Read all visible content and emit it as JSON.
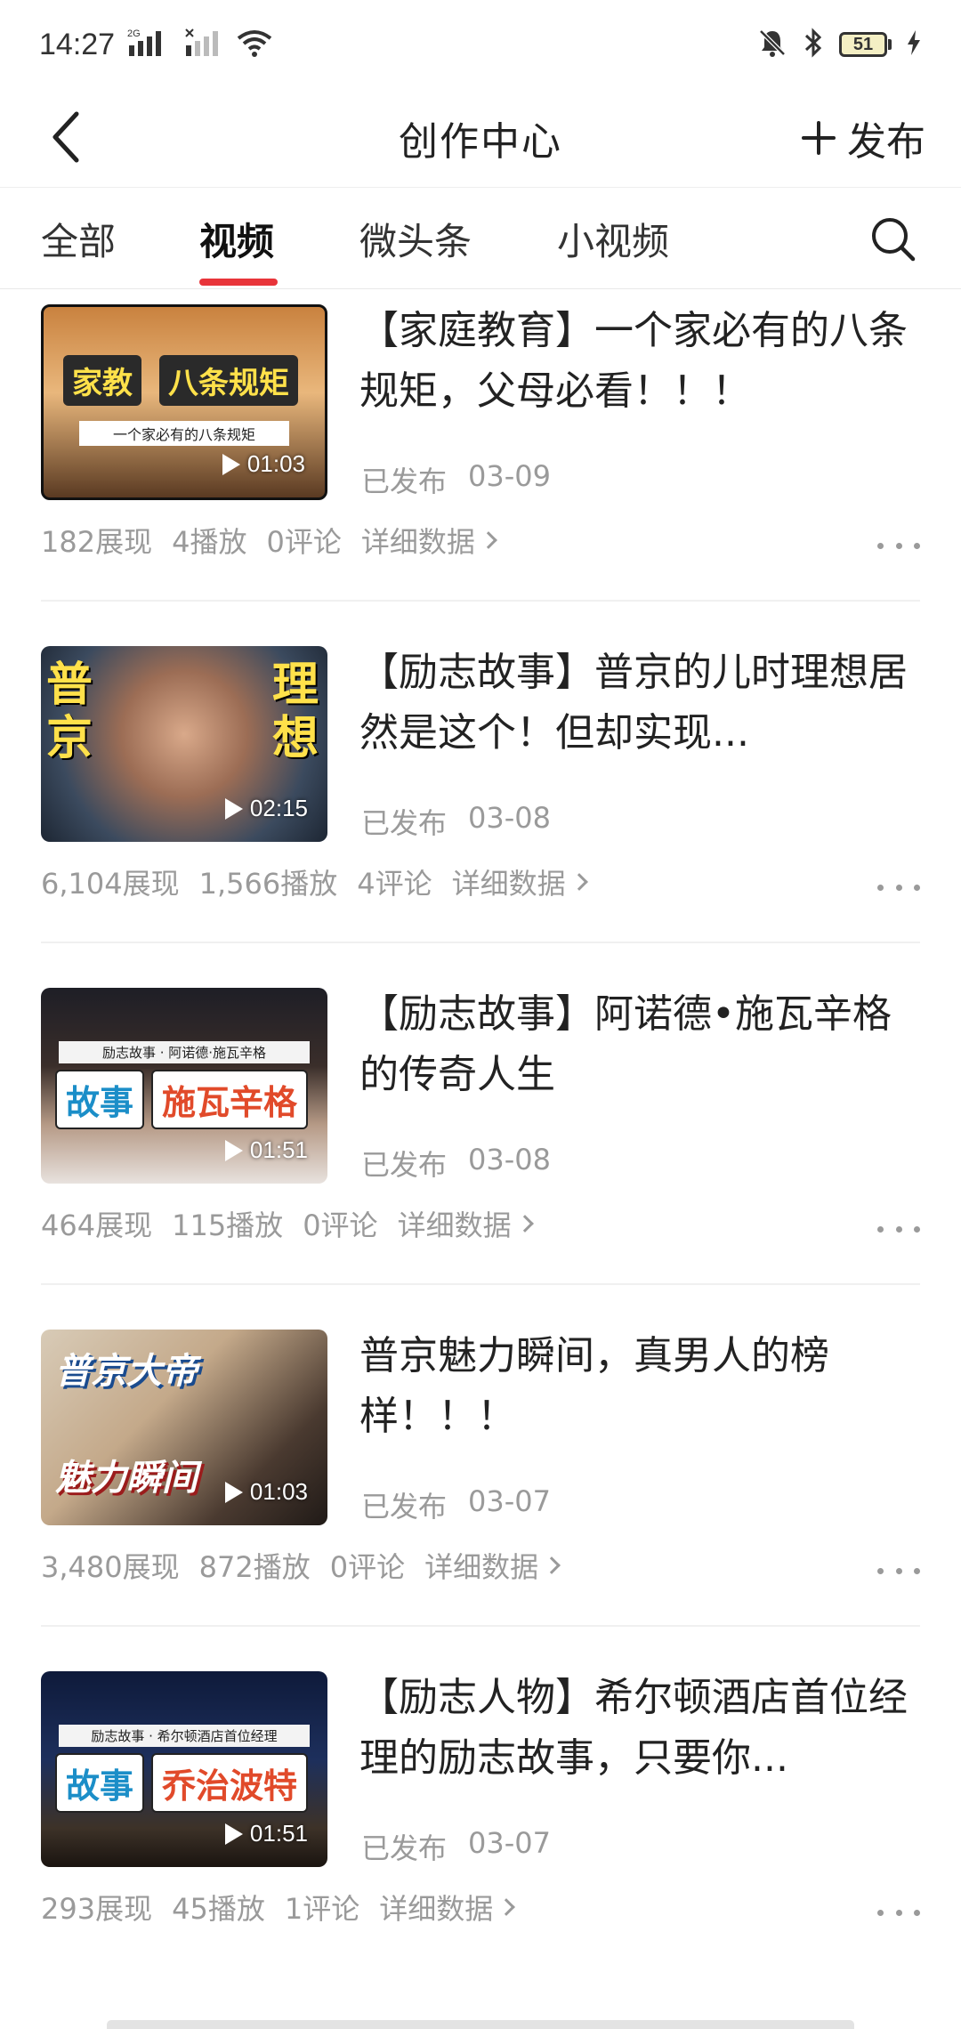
{
  "status_bar": {
    "time": "14:27",
    "network_label": "2G",
    "battery": "51"
  },
  "header": {
    "title": "创作中心",
    "publish_label": "发布"
  },
  "tabs": [
    {
      "label": "全部",
      "active": false
    },
    {
      "label": "视频",
      "active": true
    },
    {
      "label": "微头条",
      "active": false
    },
    {
      "label": "小视频",
      "active": false
    }
  ],
  "items": [
    {
      "title": "【家庭教育】一个家必有的八条规矩，父母必看！！！",
      "status": "已发布",
      "date": "03-09",
      "duration": "01:03",
      "impressions": "182展现",
      "plays": "4播放",
      "comments": "0评论",
      "detail_label": "详细数据",
      "thumb_text": {
        "left": "家教",
        "right": "八条规矩",
        "sub": "一个家必有的八条规矩"
      }
    },
    {
      "title": "【励志故事】普京的儿时理想居然是这个！但却实现...",
      "status": "已发布",
      "date": "03-08",
      "duration": "02:15",
      "impressions": "6,104展现",
      "plays": "1,566播放",
      "comments": "4评论",
      "detail_label": "详细数据",
      "thumb_text": {
        "left": "普京",
        "right": "理想",
        "sub": ""
      }
    },
    {
      "title": "【励志故事】阿诺德•施瓦辛格的传奇人生",
      "status": "已发布",
      "date": "03-08",
      "duration": "01:51",
      "impressions": "464展现",
      "plays": "115播放",
      "comments": "0评论",
      "detail_label": "详细数据",
      "thumb_text": {
        "left": "故事",
        "right": "施瓦辛格",
        "sub": "励志故事 · 阿诺德·施瓦辛格"
      }
    },
    {
      "title": "普京魅力瞬间，真男人的榜样！！！",
      "status": "已发布",
      "date": "03-07",
      "duration": "01:03",
      "impressions": "3,480展现",
      "plays": "872播放",
      "comments": "0评论",
      "detail_label": "详细数据",
      "thumb_text": {
        "left": "普京大帝",
        "right": "魅力瞬间",
        "sub": ""
      }
    },
    {
      "title": "【励志人物】希尔顿酒店首位经理的励志故事，只要你...",
      "status": "已发布",
      "date": "03-07",
      "duration": "01:51",
      "impressions": "293展现",
      "plays": "45播放",
      "comments": "1评论",
      "detail_label": "详细数据",
      "thumb_text": {
        "left": "故事",
        "right": "乔治波特",
        "sub": "励志故事 · 希尔顿酒店首位经理"
      }
    }
  ],
  "colors": {
    "accent": "#e8343a",
    "text": "#222222",
    "muted": "#9a9a9a"
  }
}
